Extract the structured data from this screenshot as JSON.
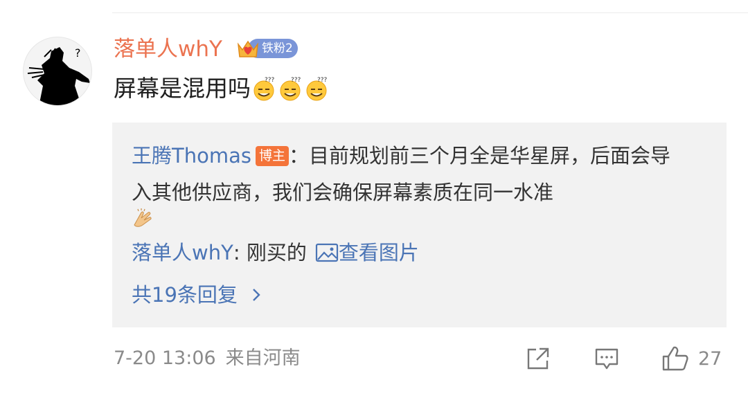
{
  "comment": {
    "username": "落单人whY",
    "fan_badge": "铁粉2",
    "text": "屏幕是混用吗",
    "emoji_icons": [
      "thinking-smile-emoji-icon",
      "thinking-smile-emoji-icon",
      "thinking-smile-emoji-icon"
    ],
    "time": "7-20 13:06",
    "location": "来自河南",
    "like_count": "27"
  },
  "replies": {
    "first": {
      "author": "王腾Thomas",
      "badge": "博主",
      "separator": "：",
      "text": "目前规划前三个月全是华星屏，后面会导入其他供应商，我们会确保屏幕素质在同一水准",
      "emoji_icon": "clapping-hands-emoji-icon"
    },
    "second": {
      "author": "落单人whY",
      "separator": ": ",
      "text": "刚买的",
      "link_label": "查看图片",
      "link_icon": "image-icon"
    },
    "more_label": "共19条回复"
  },
  "colors": {
    "username": "#eb7350",
    "link": "#4a74b5",
    "reply_bg": "#f2f2f2",
    "blogger_badge": "#f4743a",
    "fan_badge": "#7a95d8",
    "meta": "#8a8a8a"
  }
}
